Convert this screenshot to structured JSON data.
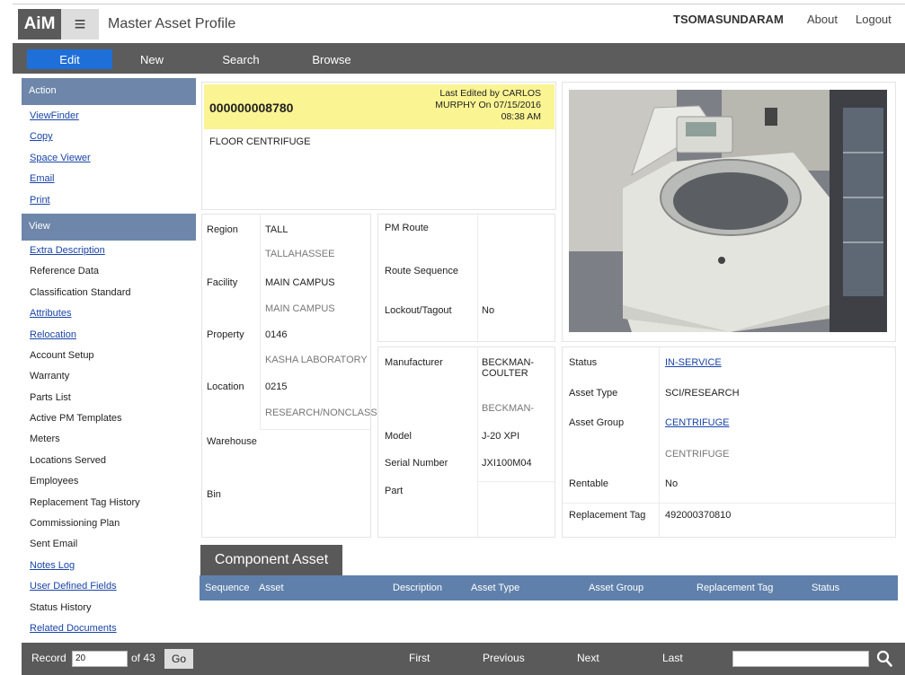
{
  "header": {
    "logo": "AiM",
    "title": "Master Asset Profile",
    "user": "TSOMASUNDARAM",
    "about": "About",
    "logout": "Logout"
  },
  "nav": {
    "edit": "Edit",
    "new": "New",
    "search": "Search",
    "browse": "Browse"
  },
  "sidebar": {
    "action_header": "Action",
    "actions": [
      "ViewFinder",
      "Copy",
      "Space Viewer",
      "Email",
      "Print"
    ],
    "view_header": "View",
    "views": [
      "Extra Description",
      "Reference Data",
      "Classification Standard",
      "Attributes",
      "Relocation",
      "Account Setup",
      "Warranty",
      "Parts List",
      "Active PM Templates",
      "Meters",
      "Locations Served",
      "Employees",
      "Replacement Tag History",
      "Commissioning Plan",
      "Sent Email",
      "Notes Log",
      "User Defined Fields",
      "Status History",
      "Related Documents"
    ]
  },
  "asset": {
    "number": "000000008780",
    "last_edited": "Last Edited by CARLOS MURPHY On 07/15/2016 08:38 AM",
    "description": "FLOOR CENTRIFUGE"
  },
  "location": {
    "region_label": "Region",
    "region": "TALL",
    "region_desc": "TALLAHASSEE",
    "facility_label": "Facility",
    "facility": "MAIN CAMPUS",
    "facility_desc": "MAIN CAMPUS",
    "property_label": "Property",
    "property": "0146",
    "property_desc": "KASHA LABORATORY",
    "location_label": "Location",
    "location": "0215",
    "location_desc": "RESEARCH/NONCLASS",
    "warehouse_label": "Warehouse",
    "bin_label": "Bin"
  },
  "pm": {
    "route_label": "PM Route",
    "sequence_label": "Route Sequence",
    "lockout_label": "Lockout/Tagout",
    "lockout": "No"
  },
  "mfr": {
    "manufacturer_label": "Manufacturer",
    "manufacturer": "BECKMAN-COULTER",
    "manufacturer_desc": "BECKMAN-",
    "model_label": "Model",
    "model": "J-20 XPI",
    "serial_label": "Serial Number",
    "serial": "JXI100M04",
    "part_label": "Part"
  },
  "status": {
    "status_label": "Status",
    "status": "IN-SERVICE",
    "type_label": "Asset Type",
    "type": "SCI/RESEARCH",
    "group_label": "Asset Group",
    "group": "CENTRIFUGE",
    "group_desc": "CENTRIFUGE",
    "rentable_label": "Rentable",
    "rentable": "No",
    "tag_label": "Replacement Tag",
    "tag": "492000370810"
  },
  "component": {
    "title": "Component Asset",
    "columns": [
      "Sequence",
      "Asset",
      "Description",
      "Asset Type",
      "Asset Group",
      "Replacement Tag",
      "Status"
    ]
  },
  "footer": {
    "record_label": "Record",
    "record_value": "20",
    "of_label": "of 43",
    "go": "Go",
    "first": "First",
    "previous": "Previous",
    "next": "Next",
    "last": "Last",
    "search_value": ""
  }
}
